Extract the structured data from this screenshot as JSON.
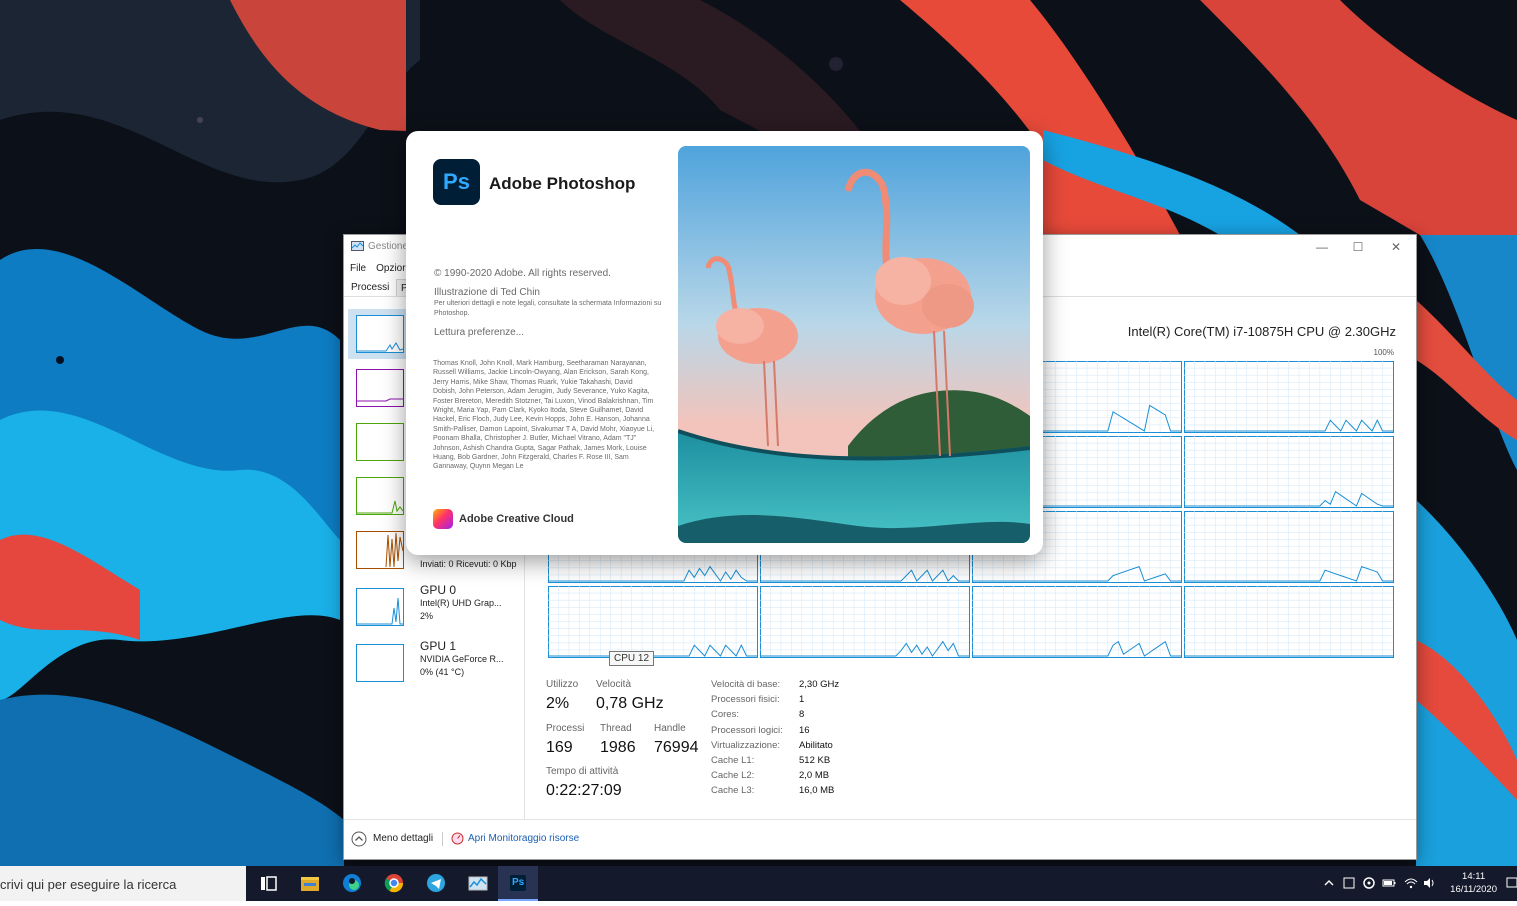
{
  "task_manager": {
    "title": "Gestione",
    "menu": [
      "File",
      "Opzior"
    ],
    "tabs": [
      "Processi",
      "Pr"
    ],
    "sidebar": [
      {
        "name": "cpu"
      },
      {
        "name": "memory"
      },
      {
        "name": "disk0"
      },
      {
        "name": "disk1"
      },
      {
        "name": "ethernet",
        "detail": "Inviati: 0 Ricevuti: 0 Kbp"
      },
      {
        "name": "gpu0",
        "title": "GPU 0",
        "subtitle": "Intel(R) UHD Grap...",
        "detail": "2%"
      },
      {
        "name": "gpu1",
        "title": "GPU 1",
        "subtitle": "NVIDIA GeForce R...",
        "detail": "0% (41 °C)"
      }
    ],
    "cpu_name": "Intel(R) Core(TM) i7-10875H CPU @ 2.30GHz",
    "graph_max": "100%",
    "tooltip": "CPU 12",
    "stats": {
      "utilizzo_label": "Utilizzo",
      "utilizzo": "2%",
      "velocita_label": "Velocità",
      "velocita": "0,78 GHz",
      "processi_label": "Processi",
      "processi": "169",
      "thread_label": "Thread",
      "thread": "1986",
      "handle_label": "Handle",
      "handle": "76994",
      "uptime_label": "Tempo di attività",
      "uptime": "0:22:27:09"
    },
    "specs": [
      {
        "k": "Velocità di base:",
        "v": "2,30 GHz"
      },
      {
        "k": "Processori fisici:",
        "v": "1"
      },
      {
        "k": "Cores:",
        "v": "8"
      },
      {
        "k": "Processori logici:",
        "v": "16"
      },
      {
        "k": "Virtualizzazione:",
        "v": "Abilitato"
      },
      {
        "k": "Cache L1:",
        "v": "512 KB"
      },
      {
        "k": "Cache L2:",
        "v": "2,0 MB"
      },
      {
        "k": "Cache L3:",
        "v": "16,0 MB"
      }
    ],
    "footer": {
      "details": "Meno dettagli",
      "monitor": "Apri Monitoraggio risorse"
    }
  },
  "splash": {
    "app_name": "Adobe Photoshop",
    "logo_text": "Ps",
    "copyright": "© 1990-2020 Adobe. All rights reserved.",
    "illustration": "Illustrazione di Ted Chin",
    "legal": "Per ulteriori dettagli e note legali, consultate la schermata Informazioni su Photoshop.",
    "loading": "Lettura preferenze...",
    "credits": "Thomas Knoll, John Knoll, Mark Hamburg, Seetharaman Narayanan, Russell Williams, Jackie Lincoln-Owyang, Alan Erickson, Sarah Kong, Jerry Harris, Mike Shaw, Thomas Ruark, Yukie Takahashi, David Dobish, John Peterson, Adam Jerugim, Judy Severance, Yuko Kagita, Foster Brereton, Meredith Stotzner, Tai Luxon, Vinod Balakrishnan, Tim Wright, Maria Yap, Pam Clark, Kyoko Itoda, Steve Guilhamet, David Hackel, Eric Floch, Judy Lee, Kevin Hopps, John E. Hanson, Johanna Smith-Palliser, Damon Lapoint, Sivakumar T A, David Mohr, Xiaoyue Li, Poonam Bhalla, Christopher J. Butler, Michael Vitrano, Adam \"TJ\" Johnson, Ashish Chandra Gupta, Sagar Pathak, James Mork, Louise Huang, Bob Gardner, John Fitzgerald, Charles F. Rose III, Sam Gannaway, Quynn Megan Le",
    "cc_label": "Adobe Creative Cloud"
  },
  "taskbar": {
    "search_text": "crivi qui per eseguire la ricerca",
    "apps": [
      "task-view",
      "file-explorer",
      "edge",
      "chrome",
      "telegram",
      "task-manager",
      "photoshop"
    ],
    "ps_label": "Ps",
    "time": "14:11",
    "date": "16/11/2020"
  },
  "colors": {
    "cpu_line": "#1a8fd6",
    "memory_line": "#8b12ae",
    "disk_line": "#4da60c",
    "ethernet_line": "#a74f01",
    "taskbar": "#14192b"
  }
}
